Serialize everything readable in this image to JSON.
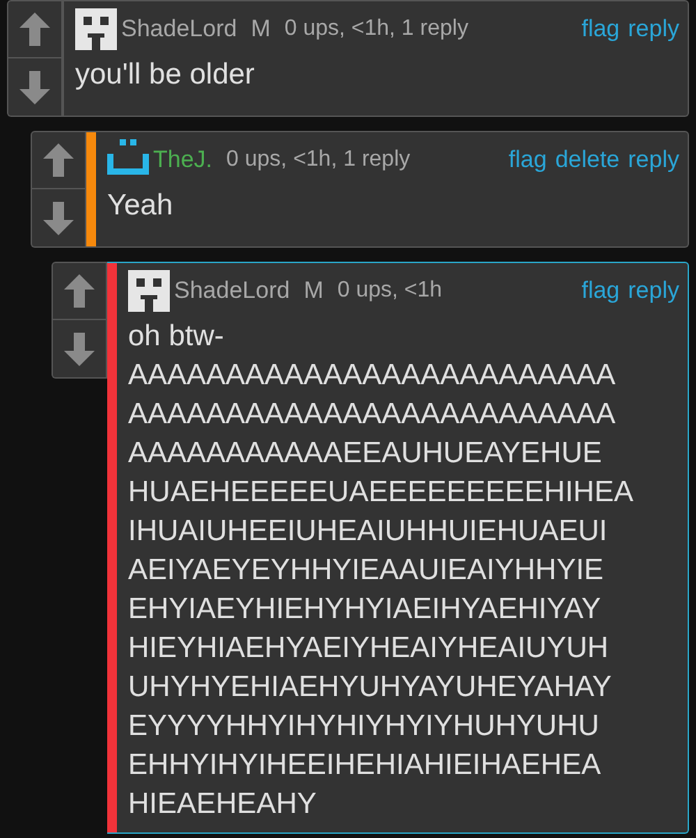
{
  "comments": [
    {
      "avatar": {
        "kind": "blocky-face"
      },
      "user": {
        "name": "ShadeLord",
        "color": "#a8a8a8"
      },
      "badge": "M",
      "meta": "0 ups, <1h, 1 reply",
      "actions": [
        "flag",
        "reply"
      ],
      "highlighted": false,
      "body": [
        "you'll be older"
      ],
      "children": [
        {
          "avatar": {
            "kind": "smiley"
          },
          "user": {
            "name": "TheJ.",
            "color": "#4caf50"
          },
          "meta": "0 ups, <1h, 1 reply",
          "actions": [
            "flag",
            "delete",
            "reply"
          ],
          "accent": {
            "color": "#f7890c"
          },
          "highlighted": false,
          "body": [
            "Yeah"
          ],
          "children": [
            {
              "avatar": {
                "kind": "blocky-face"
              },
              "user": {
                "name": "ShadeLord",
                "color": "#a8a8a8"
              },
              "badge": "M",
              "meta": "0 ups, <1h",
              "actions": [
                "flag",
                "reply"
              ],
              "accent": {
                "color": "#f2333a"
              },
              "highlighted": true,
              "body": [
                "oh btw-",
                "AAAAAAAAAAAAAAAAAAAAAAAAA",
                "AAAAAAAAAAAAAAAAAAAAAAAAA",
                "AAAAAAAAAAAEEAUHUEAYEHUE",
                "HUAEHEEEEEUAEEEEEEEEEHIHEA",
                "IHUAIUHEEIUHEAIUHHUIEHUAEUI",
                "AEIYAEYEYHHYIEAAUIEAIYHHYIE",
                "EHYIAEYHIEHYHYIAEIHYAEHIYAY",
                "HIEYHIAEHYAEIYHEAIYHEAIUYUH",
                "UHYHYEHIAEHYUHYAYUHEYAHAY",
                "EYYYYHHYIHYHIYHYIYHUHYUHU",
                "EHHYIHYIHEEIHEHIAHIEIHAEHEA",
                "HIEAEHEAHY"
              ]
            }
          ]
        }
      ]
    }
  ]
}
